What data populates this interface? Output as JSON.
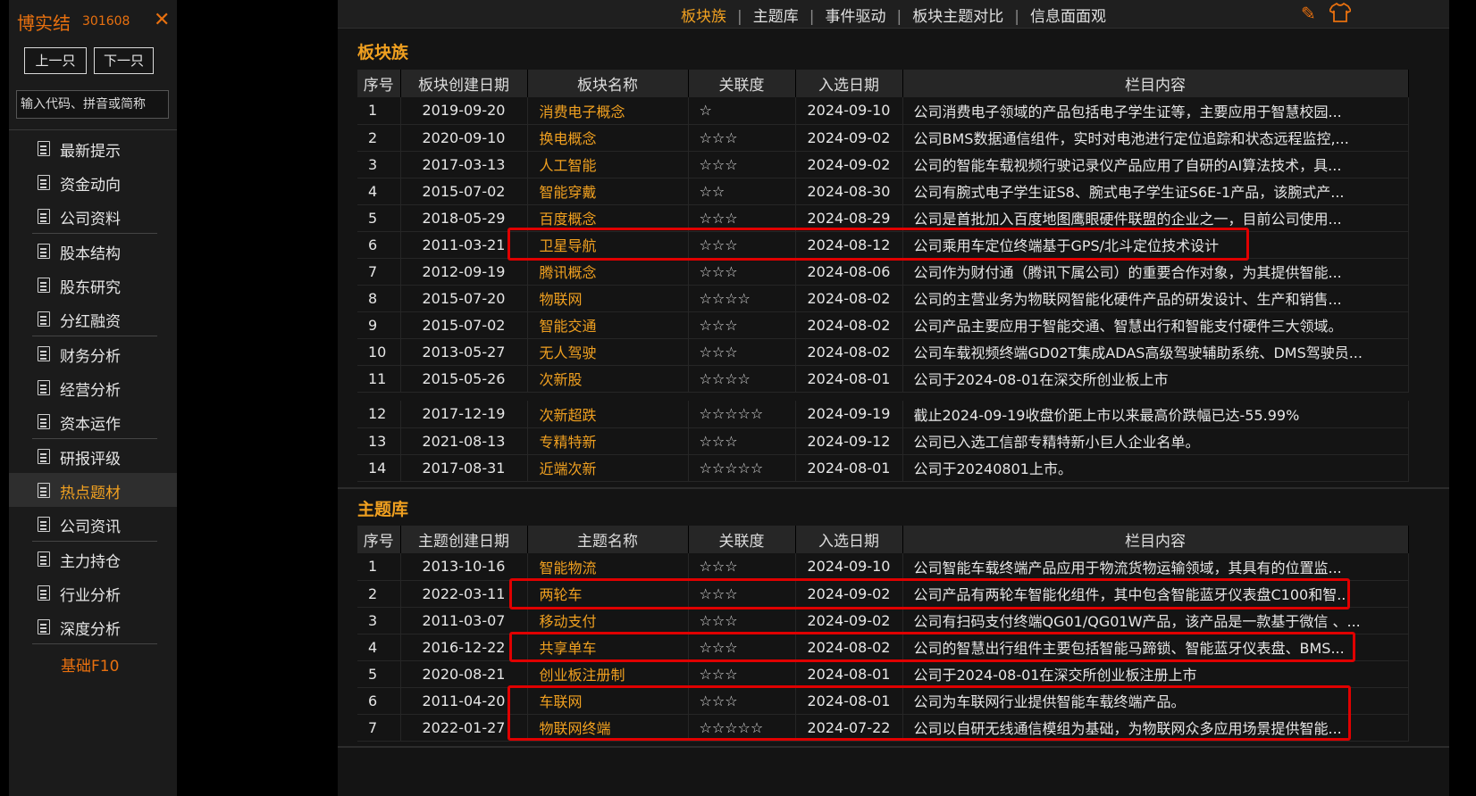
{
  "sidebar": {
    "stock_name": "博实结",
    "stock_code": "301608",
    "close_glyph": "✕",
    "prev_label": "上一只",
    "next_label": "下一只",
    "search_placeholder": "输入代码、拼音或简称",
    "menu": [
      {
        "label": "最新提示",
        "active": false,
        "sep_after": false
      },
      {
        "label": "资金动向",
        "active": false,
        "sep_after": false
      },
      {
        "label": "公司资料",
        "active": false,
        "sep_after": true
      },
      {
        "label": "股本结构",
        "active": false,
        "sep_after": false
      },
      {
        "label": "股东研究",
        "active": false,
        "sep_after": false
      },
      {
        "label": "分红融资",
        "active": false,
        "sep_after": true
      },
      {
        "label": "财务分析",
        "active": false,
        "sep_after": false
      },
      {
        "label": "经营分析",
        "active": false,
        "sep_after": false
      },
      {
        "label": "资本运作",
        "active": false,
        "sep_after": true
      },
      {
        "label": "研报评级",
        "active": false,
        "sep_after": false
      },
      {
        "label": "热点题材",
        "active": true,
        "sep_after": false
      },
      {
        "label": "公司资讯",
        "active": false,
        "sep_after": true
      },
      {
        "label": "主力持仓",
        "active": false,
        "sep_after": false
      },
      {
        "label": "行业分析",
        "active": false,
        "sep_after": false
      },
      {
        "label": "深度分析",
        "active": false,
        "sep_after": true
      }
    ],
    "f10_label": "基础F10"
  },
  "topbar": {
    "tabs": [
      {
        "label": "板块族",
        "active": true
      },
      {
        "label": "主题库",
        "active": false
      },
      {
        "label": "事件驱动",
        "active": false
      },
      {
        "label": "板块主题对比",
        "active": false
      },
      {
        "label": "信息面面观",
        "active": false
      }
    ],
    "icons": [
      "edit-icon",
      "shirt-icon"
    ]
  },
  "section1": {
    "title": "板块族",
    "headers": [
      "序号",
      "板块创建日期",
      "板块名称",
      "关联度",
      "入选日期",
      "栏目内容"
    ],
    "rows": [
      [
        "1",
        "2019-09-20",
        "消费电子概念",
        "☆",
        "2024-09-10",
        "公司消费电子领域的产品包括电子学生证等，主要应用于智慧校园..."
      ],
      [
        "2",
        "2020-09-10",
        "换电概念",
        "☆☆☆",
        "2024-09-02",
        "公司BMS数据通信组件，实时对电池进行定位追踪和状态远程监控,..."
      ],
      [
        "3",
        "2017-03-13",
        "人工智能",
        "☆☆☆",
        "2024-09-02",
        "公司的智能车载视频行驶记录仪产品应用了自研的AI算法技术，具..."
      ],
      [
        "4",
        "2015-07-02",
        "智能穿戴",
        "☆☆",
        "2024-08-30",
        "公司有腕式电子学生证S8、腕式电子学生证S6E-1产品，该腕式产..."
      ],
      [
        "5",
        "2018-05-29",
        "百度概念",
        "☆☆☆",
        "2024-08-29",
        "公司是首批加入百度地图鹰眼硬件联盟的企业之一，目前公司使用..."
      ],
      [
        "6",
        "2011-03-21",
        "卫星导航",
        "☆☆☆",
        "2024-08-12",
        "公司乘用车定位终端基于GPS/北斗定位技术设计"
      ],
      [
        "7",
        "2012-09-19",
        "腾讯概念",
        "☆☆☆",
        "2024-08-06",
        "公司作为财付通（腾讯下属公司）的重要合作对象，为其提供智能..."
      ],
      [
        "8",
        "2015-07-20",
        "物联网",
        "☆☆☆☆",
        "2024-08-02",
        "公司的主营业务为物联网智能化硬件产品的研发设计、生产和销售..."
      ],
      [
        "9",
        "2015-07-02",
        "智能交通",
        "☆☆☆",
        "2024-08-02",
        "公司产品主要应用于智能交通、智慧出行和智能支付硬件三大领域。"
      ],
      [
        "10",
        "2013-05-27",
        "无人驾驶",
        "☆☆☆",
        "2024-08-02",
        "公司车载视频终端GD02T集成ADAS高级驾驶辅助系统、DMS驾驶员..."
      ],
      [
        "11",
        "2015-05-26",
        "次新股",
        "☆☆☆☆",
        "2024-08-01",
        "公司于2024-08-01在深交所创业板上市"
      ]
    ],
    "rows2": [
      [
        "12",
        "2017-12-19",
        "次新超跌",
        "☆☆☆☆☆",
        "2024-09-19",
        "截止2024-09-19收盘价距上市以来最高价跌幅已达-55.99%"
      ],
      [
        "13",
        "2021-08-13",
        "专精特新",
        "☆☆☆",
        "2024-09-12",
        "公司已入选工信部专精特新小巨人企业名单。"
      ],
      [
        "14",
        "2017-08-31",
        "近端次新",
        "☆☆☆☆☆",
        "2024-08-01",
        "公司于20240801上市。"
      ]
    ]
  },
  "section2": {
    "title": "主题库",
    "headers": [
      "序号",
      "主题创建日期",
      "主题名称",
      "关联度",
      "入选日期",
      "栏目内容"
    ],
    "rows": [
      [
        "1",
        "2013-10-16",
        "智能物流",
        "☆☆☆",
        "2024-09-10",
        "公司智能车载终端产品应用于物流货物运输领域，其具有的位置监..."
      ],
      [
        "2",
        "2022-03-11",
        "两轮车",
        "☆☆☆",
        "2024-09-02",
        "公司产品有两轮车智能化组件，其中包含智能蓝牙仪表盘C100和智..."
      ],
      [
        "3",
        "2011-03-07",
        "移动支付",
        "☆☆☆",
        "2024-09-02",
        "公司有扫码支付终端QG01/QG01W产品，该产品是一款基于微信 、..."
      ],
      [
        "4",
        "2016-12-22",
        "共享单车",
        "☆☆☆",
        "2024-08-02",
        "公司的智慧出行组件主要包括智能马蹄锁、智能蓝牙仪表盘、BMS..."
      ],
      [
        "5",
        "2020-08-21",
        "创业板注册制",
        "☆☆☆",
        "2024-08-01",
        "公司于2024-08-01在深交所创业板注册上市"
      ],
      [
        "6",
        "2011-04-20",
        "车联网",
        "☆☆☆",
        "2024-08-01",
        "公司为车联网行业提供智能车载终端产品。"
      ],
      [
        "7",
        "2022-01-27",
        "物联网终端",
        "☆☆☆☆☆",
        "2024-07-22",
        "公司以自研无线通信模组为基础，为物联网众多应用场景提供智能..."
      ]
    ]
  },
  "colors": {
    "accent": "#f0a020",
    "brand": "#e8700f",
    "highlight": "#e00000",
    "background": "#141414"
  }
}
